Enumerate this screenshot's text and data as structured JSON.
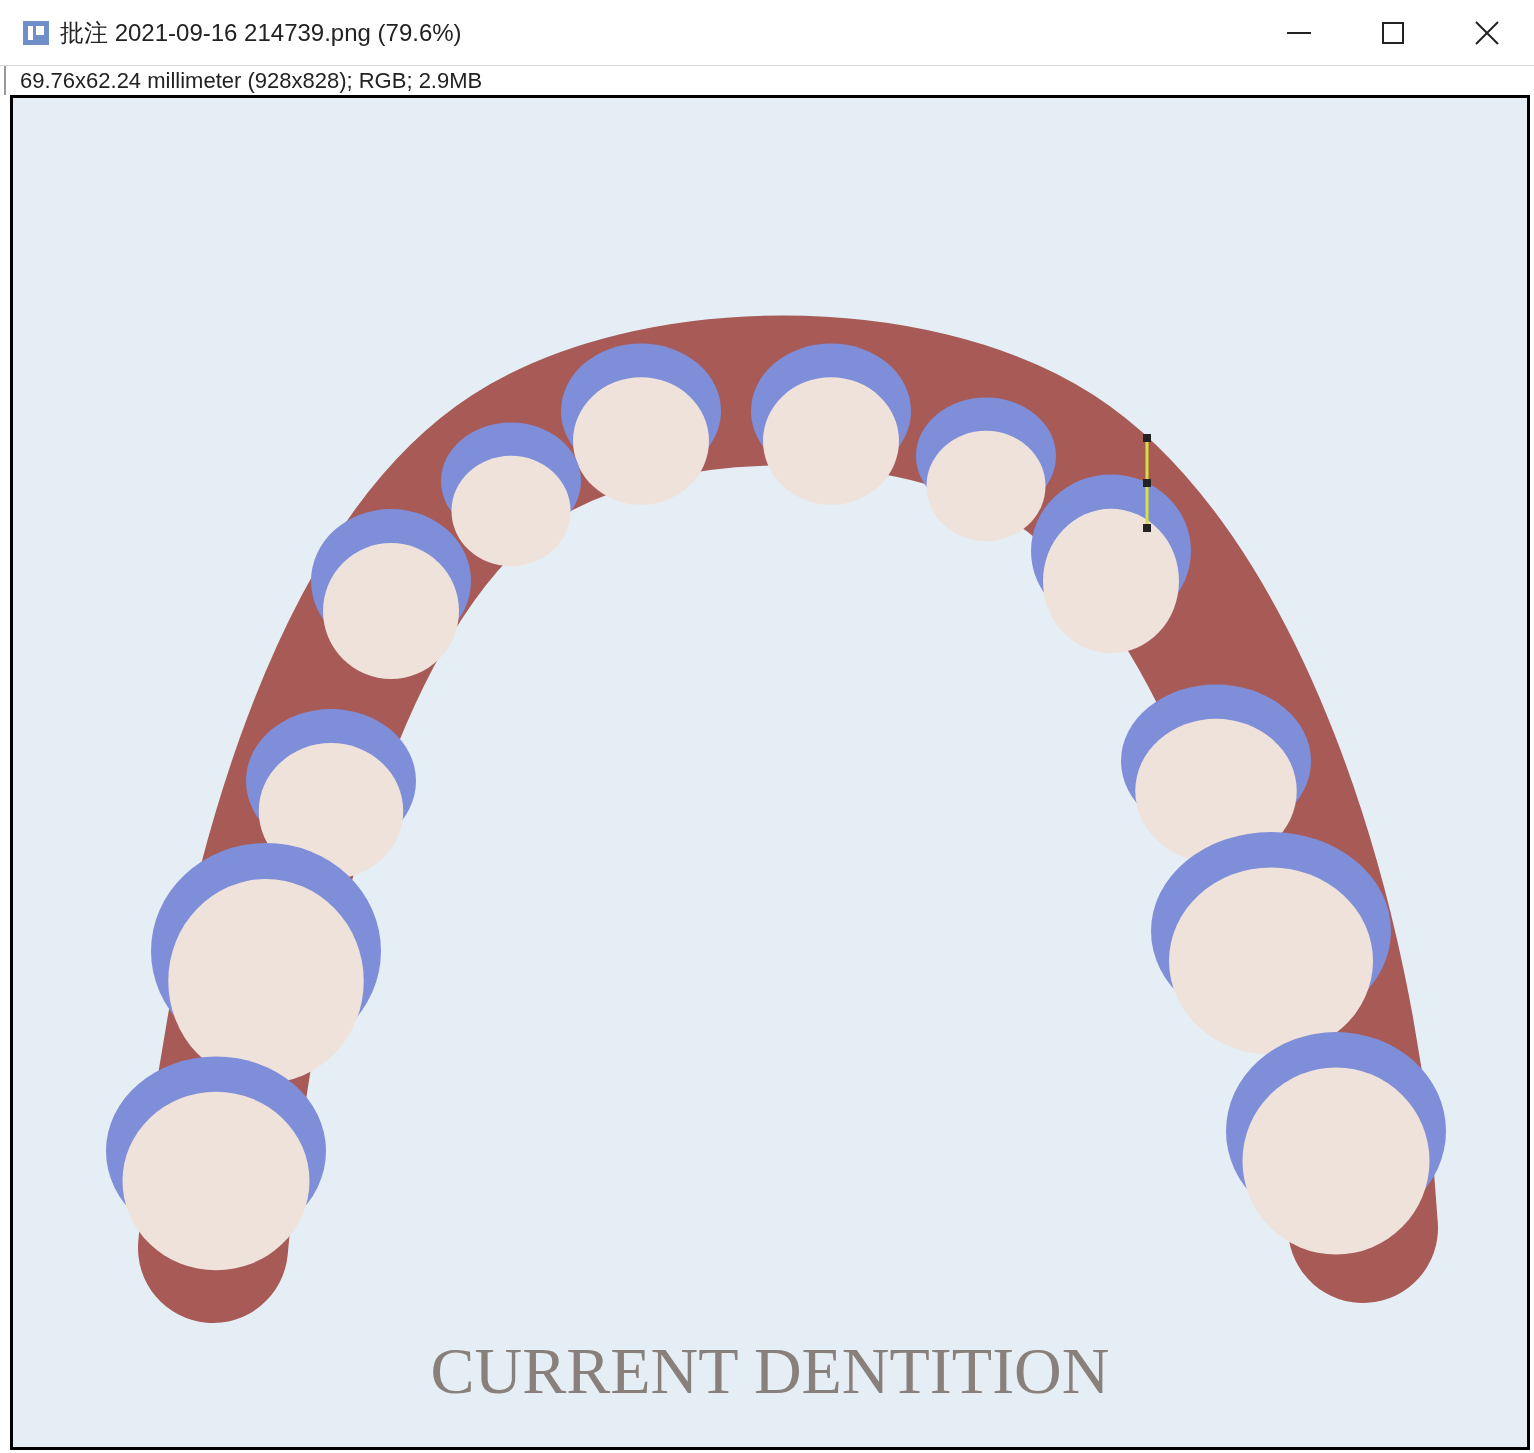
{
  "window": {
    "title": "批注 2021-09-16 214739.png (79.6%)"
  },
  "image_info": "69.76x62.24 millimeter (928x828); RGB; 2.9MB",
  "image": {
    "caption": "CURRENT DENTITION"
  }
}
